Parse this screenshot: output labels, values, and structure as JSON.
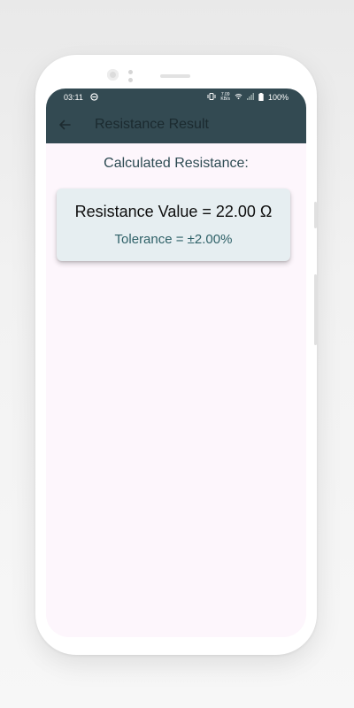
{
  "status": {
    "time": "03:11",
    "speed_value": "7.09",
    "speed_unit": "KB/s",
    "battery": "100%",
    "icons": [
      "notification-icon",
      "vibrate-icon",
      "wifi-icon",
      "signal-icon",
      "battery-icon"
    ]
  },
  "app_bar": {
    "title": "Resistance Result",
    "back_icon": "arrow-left-icon"
  },
  "result": {
    "heading": "Calculated Resistance:",
    "value": "Resistance Value = 22.00 Ω",
    "tolerance": "Tolerance = ±2.00%"
  },
  "colors": {
    "app_bar": "#334a52",
    "screen_bg": "#fdf6fc",
    "card_bg": "#e6eef1",
    "heading_text": "#2e4b53",
    "tolerance_text": "#2f6168"
  }
}
